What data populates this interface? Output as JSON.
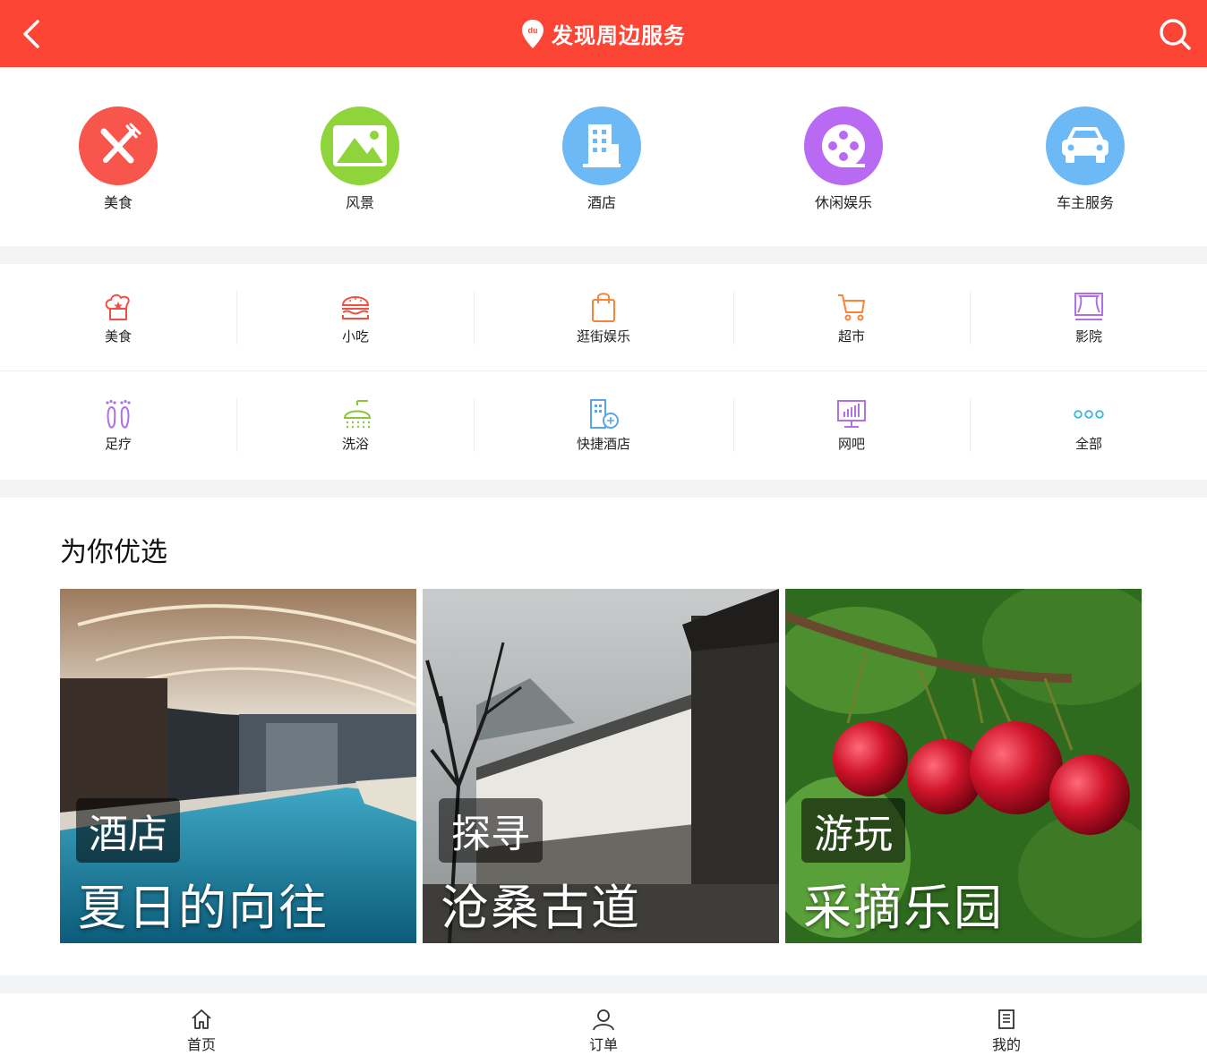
{
  "header": {
    "title": "发现周边服务"
  },
  "big_categories": [
    {
      "label": "美食",
      "color": "#f8554d",
      "icon": "fork-knife-icon"
    },
    {
      "label": "风景",
      "color": "#8fd43a",
      "icon": "mountain-icon"
    },
    {
      "label": "酒店",
      "color": "#6db9f5",
      "icon": "building-icon"
    },
    {
      "label": "休闲娱乐",
      "color": "#b96af3",
      "icon": "film-reel-icon"
    },
    {
      "label": "车主服务",
      "color": "#6db9f5",
      "icon": "car-icon"
    }
  ],
  "small_categories": [
    {
      "label": "美食",
      "color": "#f24f43",
      "icon": "chef-hat-icon"
    },
    {
      "label": "小吃",
      "color": "#f24f43",
      "icon": "burger-icon"
    },
    {
      "label": "逛街娱乐",
      "color": "#f88339",
      "icon": "shopping-bag-icon"
    },
    {
      "label": "超市",
      "color": "#f88339",
      "icon": "cart-icon"
    },
    {
      "label": "影院",
      "color": "#b070e8",
      "icon": "cinema-screen-icon"
    },
    {
      "label": "足疗",
      "color": "#b070e8",
      "icon": "footprint-icon"
    },
    {
      "label": "洗浴",
      "color": "#8bc53f",
      "icon": "shower-icon"
    },
    {
      "label": "快捷酒店",
      "color": "#5aa6e8",
      "icon": "hotel-icon"
    },
    {
      "label": "网吧",
      "color": "#b070e8",
      "icon": "monitor-icon"
    },
    {
      "label": "全部",
      "color": "#3bb8d8",
      "icon": "more-dots-icon"
    }
  ],
  "recommend": {
    "title": "为你优选",
    "cards": [
      {
        "badge": "酒店",
        "caption": "夏日的向往"
      },
      {
        "badge": "探寻",
        "caption": "沧桑古道"
      },
      {
        "badge": "游玩",
        "caption": "采摘乐园"
      }
    ]
  },
  "tabs": [
    {
      "label": "首页",
      "icon": "home-icon"
    },
    {
      "label": "订单",
      "icon": "user-icon"
    },
    {
      "label": "我的",
      "icon": "list-icon"
    }
  ]
}
